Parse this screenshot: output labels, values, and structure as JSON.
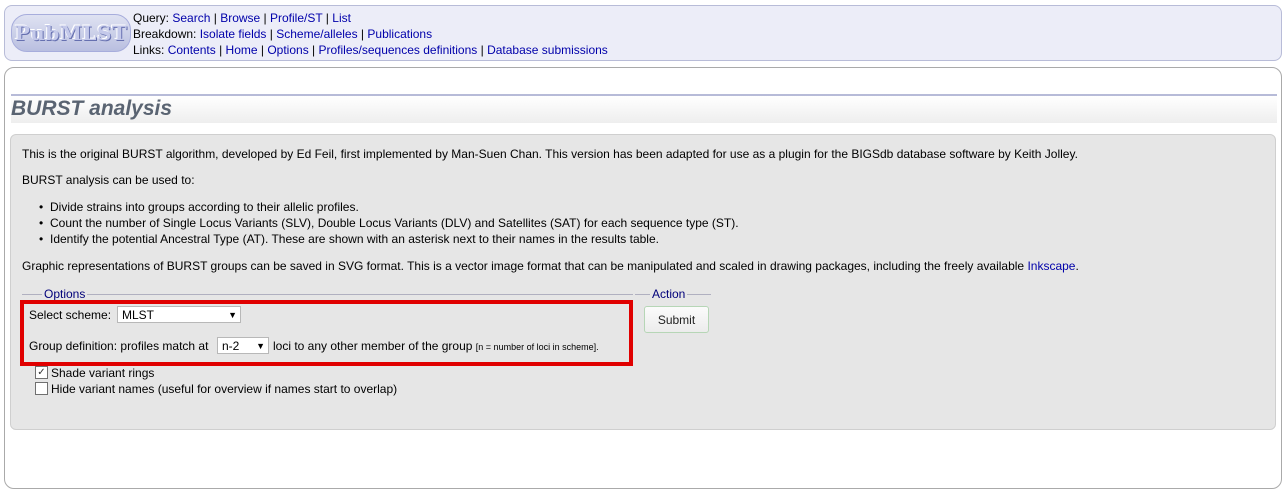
{
  "header": {
    "logo_text": "PubMLST",
    "query_label": "Query:",
    "query_links": [
      "Search",
      "Browse",
      "Profile/ST",
      "List"
    ],
    "breakdown_label": "Breakdown:",
    "breakdown_links": [
      "Isolate fields",
      "Scheme/alleles",
      "Publications"
    ],
    "links_label": "Links:",
    "links_links": [
      "Contents",
      "Home",
      "Options",
      "Profiles/sequences definitions",
      "Database submissions"
    ]
  },
  "page": {
    "title": "BURST analysis",
    "intro": "This is the original BURST algorithm, developed by Ed Feil, first implemented by Man-Suen Chan. This version has been adapted for use as a plugin for the BIGSdb database software by Keith Jolley.",
    "usage": "BURST analysis can be used to:",
    "bullets": [
      "Divide strains into groups according to their allelic profiles.",
      "Count the number of Single Locus Variants (SLV), Double Locus Variants (DLV) and Satellites (SAT) for each sequence type (ST).",
      "Identify the potential Ancestral Type (AT). These are shown with an asterisk next to their names in the results table."
    ],
    "graphic_text": "Graphic representations of BURST groups can be saved in SVG format. This is a vector image format that can be manipulated and scaled in drawing packages, including the freely available",
    "inkscape_link": "Inkscape",
    "period": "."
  },
  "options": {
    "legend": "Options",
    "scheme_label": "Select scheme:",
    "scheme_value": "MLST",
    "group_label": "Group definition: profiles match at",
    "group_value": "n-2",
    "group_suffix": "loci to any other member of the group",
    "group_note": "[n = number of loci in scheme].",
    "shade_label": "Shade variant rings",
    "shade_checked": true,
    "hide_label": "Hide variant names (useful for overview if names start to overlap)",
    "hide_checked": false
  },
  "action": {
    "legend": "Action",
    "submit_label": "Submit"
  },
  "colors": {
    "highlight": "#e00000",
    "link": "#0000aa"
  }
}
